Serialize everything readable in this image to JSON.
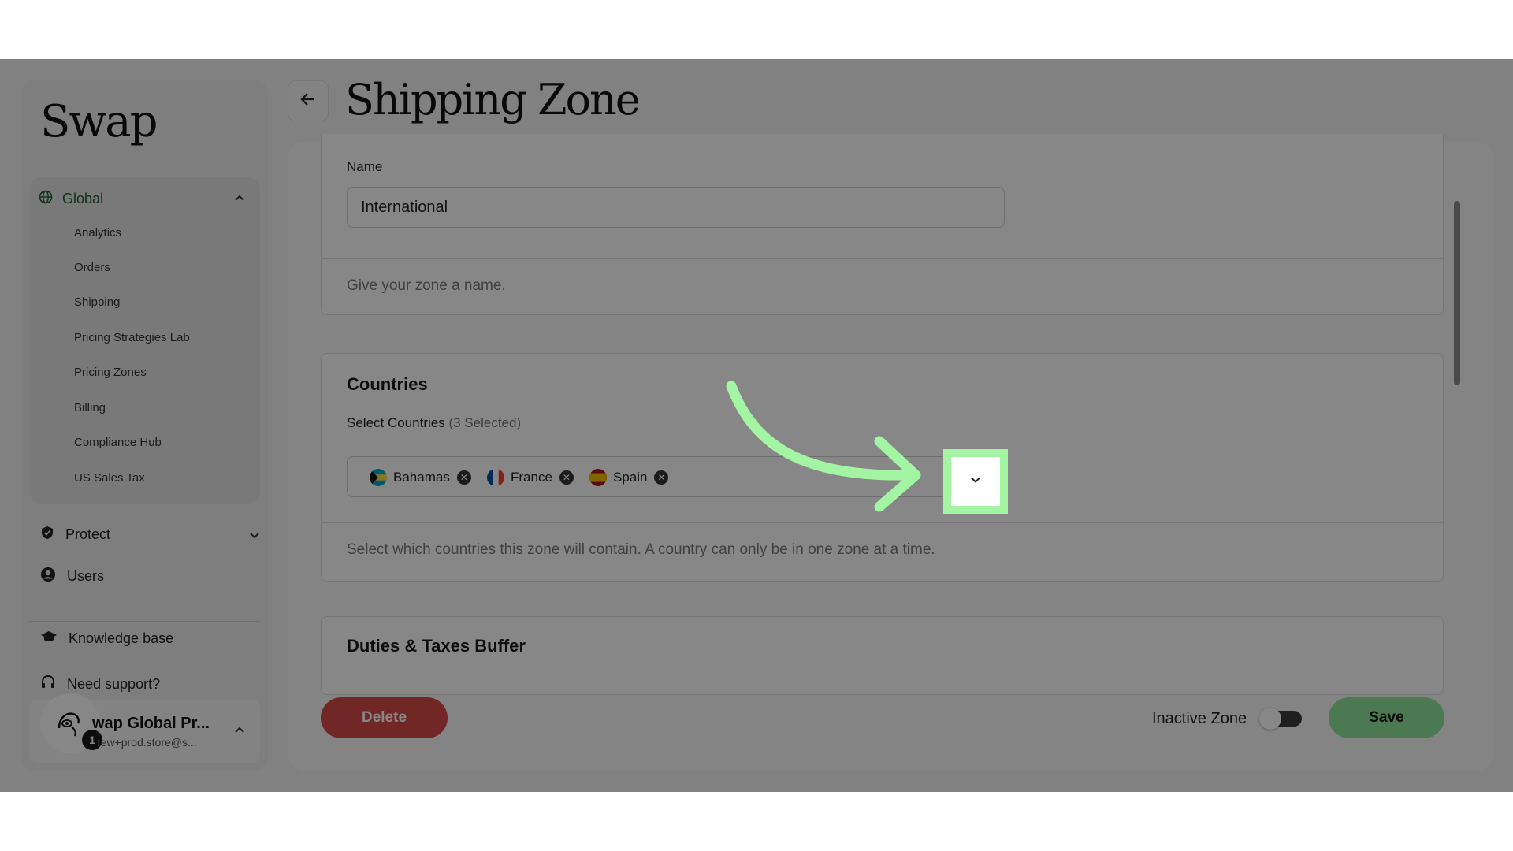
{
  "sidebar": {
    "logo": "Swap",
    "global": {
      "label": "Global",
      "items": [
        "Analytics",
        "Orders",
        "Shipping",
        "Pricing Strategies Lab",
        "Pricing Zones",
        "Billing",
        "Compliance Hub",
        "US Sales Tax"
      ]
    },
    "protect_label": "Protect",
    "users_label": "Users",
    "knowledge_label": "Knowledge base",
    "support_label": "Need support?",
    "account": {
      "name": "wap Global Pr...",
      "email": "rew+prod.store@s...",
      "badge": "1"
    }
  },
  "header": {
    "title": "Shipping Zone"
  },
  "name_section": {
    "label": "Name",
    "value": "International",
    "help": "Give your zone a name."
  },
  "countries_section": {
    "title": "Countries",
    "select_label": "Select Countries",
    "select_count": "(3 Selected)",
    "chips": [
      "Bahamas",
      "France",
      "Spain"
    ],
    "help": "Select which countries this zone will contain. A country can only be in one zone at a time."
  },
  "duties_section": {
    "title": "Duties & Taxes Buffer"
  },
  "footer": {
    "delete_label": "Delete",
    "inactive_label": "Inactive Zone",
    "save_label": "Save"
  },
  "colors": {
    "overlay": "#000000",
    "highlight": "#a3f5a3",
    "delete": "#d84a4a",
    "save": "#8fe49a",
    "nav_active": "#1d5c3a"
  }
}
